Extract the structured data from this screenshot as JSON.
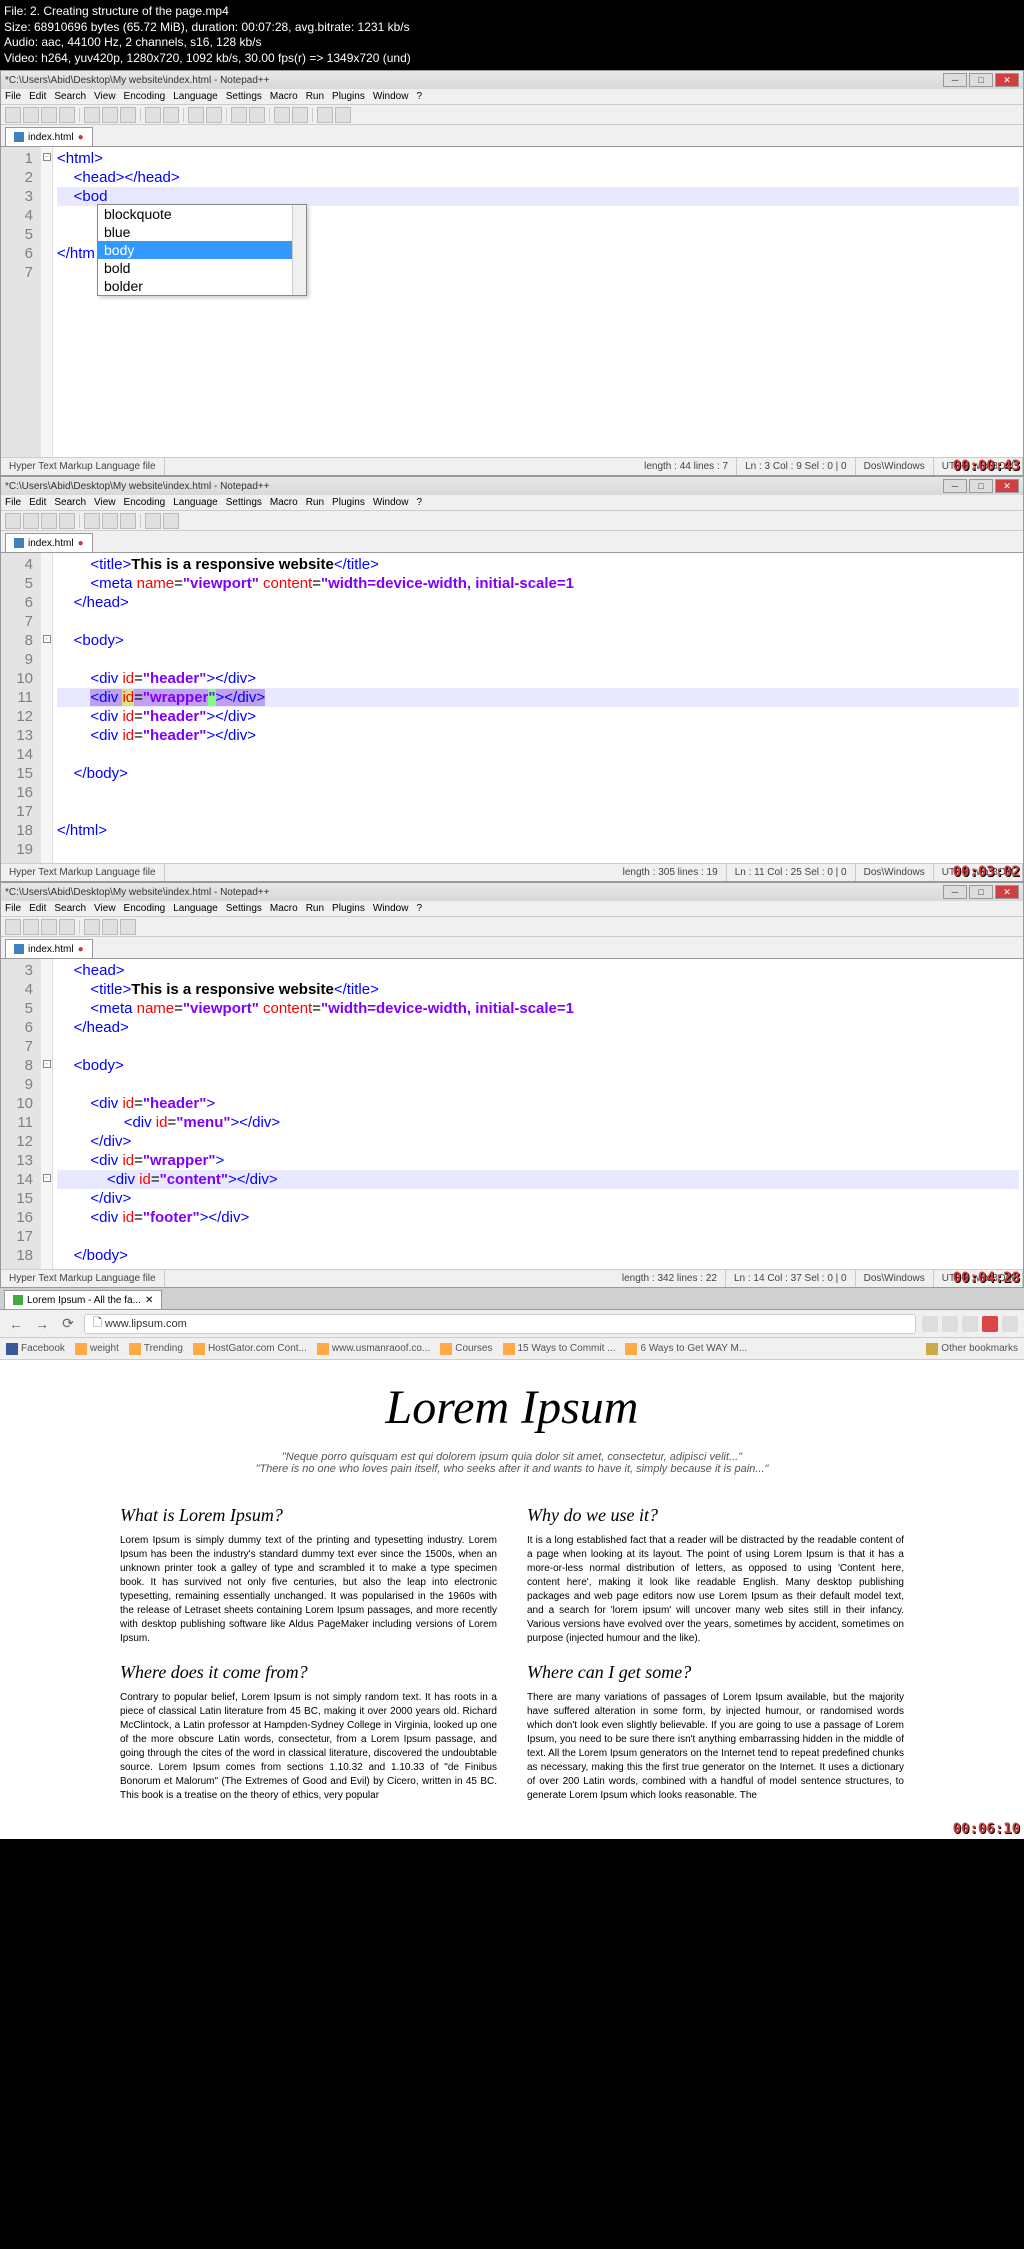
{
  "overlay": {
    "file": "File: 2. Creating structure of the page.mp4",
    "size": "Size: 68910696 bytes (65.72 MiB), duration: 00:07:28, avg.bitrate: 1231 kb/s",
    "audio": "Audio: aac, 44100 Hz, 2 channels, s16, 128 kb/s",
    "video": "Video: h264, yuv420p, 1280x720, 1092 kb/s, 30.00 fps(r) => 1349x720 (und)"
  },
  "npp": {
    "title": "*C:\\Users\\Abid\\Desktop\\My website\\index.html - Notepad++",
    "menus": [
      "File",
      "Edit",
      "Search",
      "View",
      "Encoding",
      "Language",
      "Settings",
      "Macro",
      "Run",
      "Plugins",
      "Window",
      "?"
    ],
    "tab": "index.html",
    "status_left": "Hyper Text Markup Language file"
  },
  "pane1": {
    "lines": [
      "1",
      "2",
      "3",
      "4",
      "5",
      "6",
      "7"
    ],
    "ac": [
      "blockquote",
      "blue",
      "body",
      "bold",
      "bolder"
    ],
    "sb": {
      "len": "length : 44    lines : 7",
      "pos": "Ln : 3    Col : 9    Sel : 0 | 0",
      "dos": "Dos\\Windows",
      "enc": "UTF-8 w/o BOM"
    },
    "ts": "00:00:43"
  },
  "pane2": {
    "lines": [
      "4",
      "5",
      "6",
      "7",
      "8",
      "9",
      "10",
      "11",
      "12",
      "13",
      "14",
      "15",
      "16",
      "17",
      "18",
      "19"
    ],
    "sb": {
      "len": "length : 305    lines : 19",
      "pos": "Ln : 11    Col : 25    Sel : 0 | 0",
      "dos": "Dos\\Windows",
      "enc": "UTF-8 w/o BOM"
    },
    "ts": "00:03:02",
    "title_text": "This is a responsive website"
  },
  "pane3": {
    "lines": [
      "3",
      "4",
      "5",
      "6",
      "7",
      "8",
      "9",
      "10",
      "11",
      "12",
      "13",
      "14",
      "15",
      "16",
      "17",
      "18"
    ],
    "sb": {
      "len": "length : 342    lines : 22",
      "pos": "Ln : 14    Col : 37    Sel : 0 | 0",
      "dos": "Dos\\Windows",
      "enc": "UTF-8 w/o BOM"
    },
    "ts": "00:04:28",
    "title_text": "This is a responsive website"
  },
  "browser": {
    "tab": "Lorem Ipsum - All the fa...",
    "url": "www.lipsum.com",
    "bookmarks": [
      "Facebook",
      "weight",
      "Trending",
      "HostGator.com Cont...",
      "www.usmanraoof.co...",
      "Courses",
      "15 Ways to Commit ...",
      "6 Ways to Get WAY M...",
      "Other bookmarks"
    ],
    "title": "Lorem Ipsum",
    "quote1": "\"Neque porro quisquam est qui dolorem ipsum quia dolor sit amet, consectetur, adipisci velit...\"",
    "quote2": "\"There is no one who loves pain itself, who seeks after it and wants to have it, simply because it is pain...\"",
    "h1": "What is Lorem Ipsum?",
    "p1": "Lorem Ipsum is simply dummy text of the printing and typesetting industry. Lorem Ipsum has been the industry's standard dummy text ever since the 1500s, when an unknown printer took a galley of type and scrambled it to make a type specimen book. It has survived not only five centuries, but also the leap into electronic typesetting, remaining essentially unchanged. It was popularised in the 1960s with the release of Letraset sheets containing Lorem Ipsum passages, and more recently with desktop publishing software like Aldus PageMaker including versions of Lorem Ipsum.",
    "h2": "Why do we use it?",
    "p2": "It is a long established fact that a reader will be distracted by the readable content of a page when looking at its layout. The point of using Lorem Ipsum is that it has a more-or-less normal distribution of letters, as opposed to using 'Content here, content here', making it look like readable English. Many desktop publishing packages and web page editors now use Lorem Ipsum as their default model text, and a search for 'lorem ipsum' will uncover many web sites still in their infancy. Various versions have evolved over the years, sometimes by accident, sometimes on purpose (injected humour and the like).",
    "h3": "Where does it come from?",
    "p3": "Contrary to popular belief, Lorem Ipsum is not simply random text. It has roots in a piece of classical Latin literature from 45 BC, making it over 2000 years old. Richard McClintock, a Latin professor at Hampden-Sydney College in Virginia, looked up one of the more obscure Latin words, consectetur, from a Lorem Ipsum passage, and going through the cites of the word in classical literature, discovered the undoubtable source. Lorem Ipsum comes from sections 1.10.32 and 1.10.33 of \"de Finibus Bonorum et Malorum\" (The Extremes of Good and Evil) by Cicero, written in 45 BC. This book is a treatise on the theory of ethics, very popular",
    "h4": "Where can I get some?",
    "p4": "There are many variations of passages of Lorem Ipsum available, but the majority have suffered alteration in some form, by injected humour, or randomised words which don't look even slightly believable. If you are going to use a passage of Lorem Ipsum, you need to be sure there isn't anything embarrassing hidden in the middle of text. All the Lorem Ipsum generators on the Internet tend to repeat predefined chunks as necessary, making this the first true generator on the Internet. It uses a dictionary of over 200 Latin words, combined with a handful of model sentence structures, to generate Lorem Ipsum which looks reasonable. The",
    "ts": "00:06:10"
  }
}
